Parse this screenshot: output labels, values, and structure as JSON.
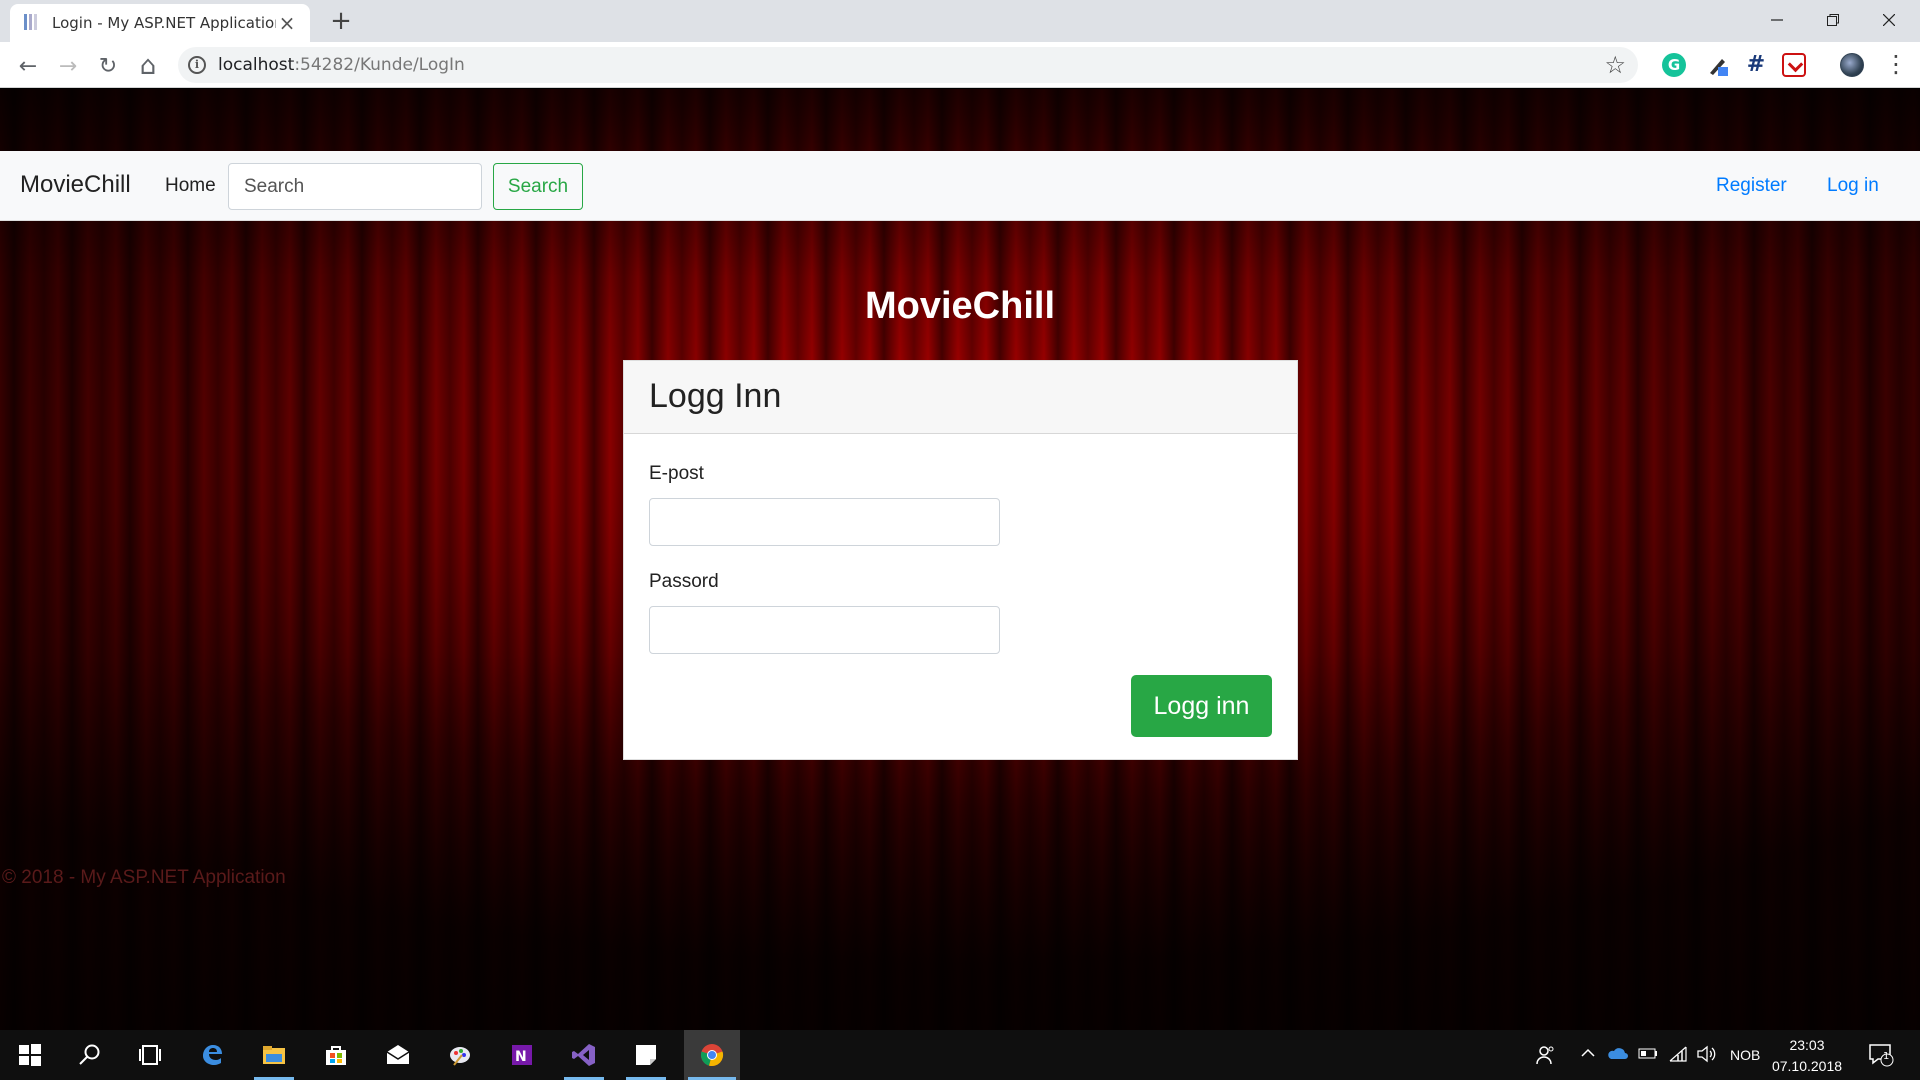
{
  "browser": {
    "tab_title": "Login - My ASP.NET Application",
    "tab_close": "×",
    "new_tab": "+",
    "url_host": "localhost",
    "url_path": ":54282/Kunde/LogIn",
    "window_controls": {
      "minimize": "—",
      "maximize": "❐",
      "close": "✕"
    },
    "nav": {
      "back": "←",
      "forward": "→",
      "reload": "↻",
      "home": "⌂"
    },
    "star": "☆",
    "menu": "⋮",
    "extensions": {
      "grammarly": "G",
      "grid": "#"
    }
  },
  "navbar": {
    "brand": "MovieChill",
    "home": "Home",
    "search_placeholder": "Search",
    "search_button": "Search",
    "register": "Register",
    "login": "Log in"
  },
  "hero": {
    "title": "MovieChill"
  },
  "login_card": {
    "title": "Logg Inn",
    "email_label": "E-post",
    "email_value": "",
    "password_label": "Passord",
    "password_value": "",
    "submit": "Logg inn"
  },
  "footer": {
    "text": "© 2018 - My ASP.NET Application"
  },
  "taskbar": {
    "apps": [
      "start-icon",
      "search-icon",
      "task-view-icon",
      "edge-icon",
      "file-explorer-icon",
      "store-icon",
      "mail-icon",
      "paint-icon",
      "onenote-icon",
      "visual-studio-icon",
      "sticky-notes-icon",
      "chrome-icon"
    ],
    "language": "NOB",
    "time": "23:03",
    "date": "07.10.2018",
    "notifications": "1"
  },
  "colors": {
    "accent_green": "#28a745",
    "link_blue": "#007bff",
    "curtain_red": "#b30000"
  }
}
